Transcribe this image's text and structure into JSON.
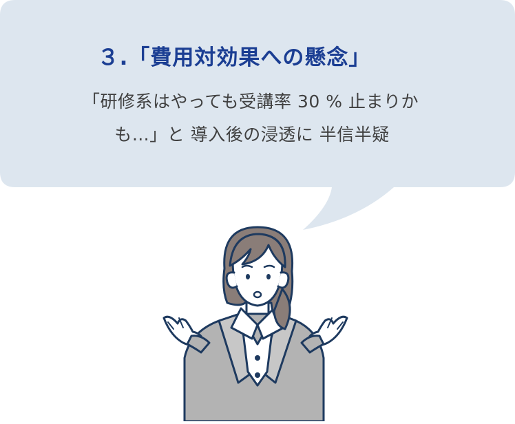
{
  "bubble": {
    "heading": "３.「費用対効果への懸念」",
    "line1": "「研修系はやっても受講率 30 % 止まりか",
    "line2": "も…」と 導入後の浸透に 半信半疑"
  },
  "colors": {
    "bubble_fill": "#dde6ef",
    "heading_color": "#1b3e93",
    "body_text": "#404040",
    "outline": "#1e3a5f",
    "hair": "#8a7d78",
    "jacket": "#b3b3b3",
    "skin": "#ffffff"
  },
  "icons": {
    "figure": "woman-shrugging-illustration"
  }
}
